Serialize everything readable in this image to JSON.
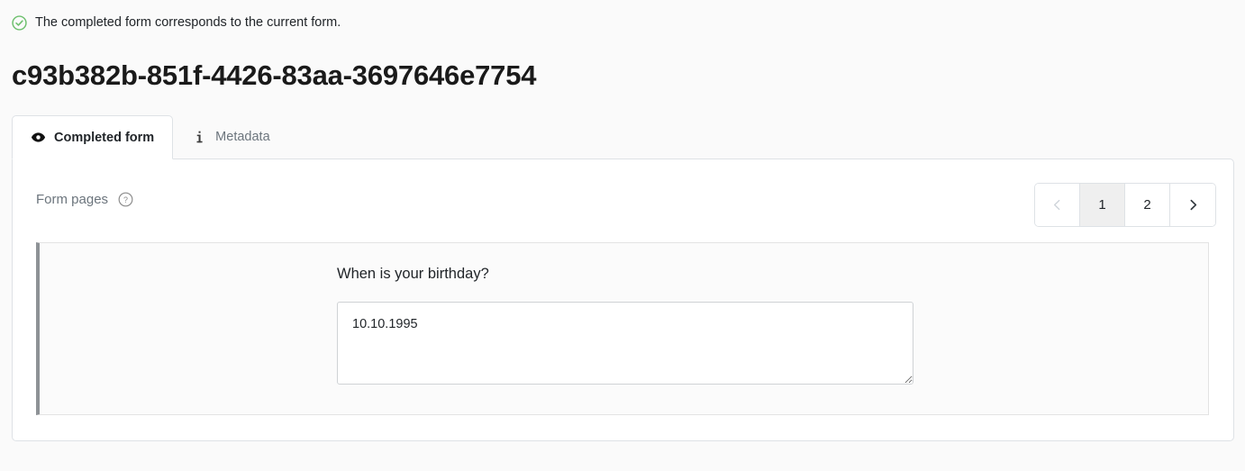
{
  "status": {
    "icon": "check-circle-icon",
    "message": "The completed form corresponds to the current form.",
    "color": "#5cb85c"
  },
  "page": {
    "title": "c93b382b-851f-4426-83aa-3697646e7754"
  },
  "tabs": [
    {
      "label": "Completed form",
      "icon": "eye-icon",
      "active": true
    },
    {
      "label": "Metadata",
      "icon": "info-icon",
      "active": false
    }
  ],
  "form_pages": {
    "label": "Form pages",
    "help_icon": "question-circle-icon"
  },
  "pagination": {
    "prev_icon": "chevron-left-icon",
    "next_icon": "chevron-right-icon",
    "pages": [
      "1",
      "2"
    ],
    "current": "1"
  },
  "form": {
    "question": "When is your birthday?",
    "answer": "10.10.1995",
    "answer_placeholder": "",
    "resize_handle_icon": "resize-grip-icon"
  }
}
